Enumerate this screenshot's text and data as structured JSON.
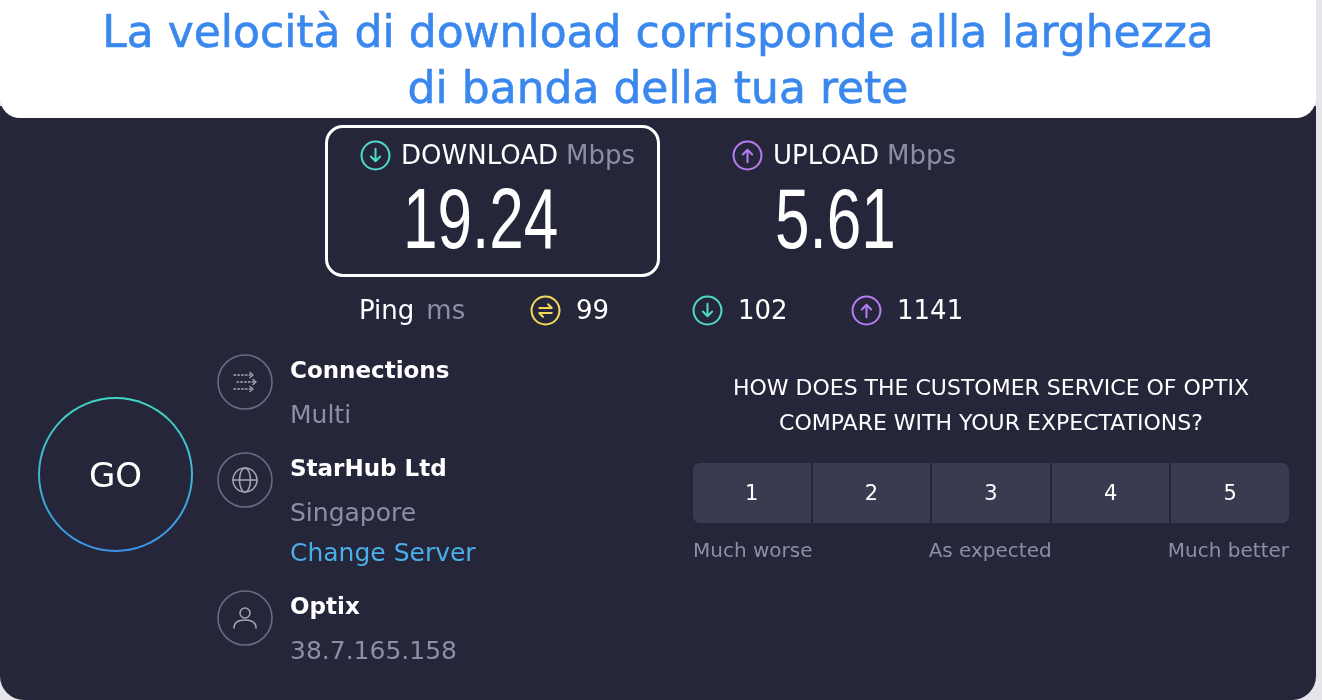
{
  "banner": {
    "text": "La velocità di download corrisponde alla larghezza di banda della tua rete"
  },
  "results": [
    {
      "kind": "download",
      "label": "DOWNLOAD",
      "unit": "Mbps",
      "value": "19.24",
      "color": "#4fd8c9",
      "selected": true
    },
    {
      "kind": "upload",
      "label": "UPLOAD",
      "unit": "Mbps",
      "value": "5.61",
      "color": "#b57cf0",
      "selected": false
    }
  ],
  "ping": {
    "label": "Ping",
    "unit": "ms",
    "values": [
      {
        "kind": "idle",
        "value": "99",
        "color": "#f2d95c"
      },
      {
        "kind": "download",
        "value": "102",
        "color": "#4fd8c9"
      },
      {
        "kind": "upload",
        "value": "1141",
        "color": "#b57cf0"
      }
    ]
  },
  "go_button": {
    "label": "GO"
  },
  "details": [
    {
      "kind": "connections",
      "title": "Connections",
      "subtitle": "Multi"
    },
    {
      "kind": "server",
      "title": "StarHub Ltd",
      "subtitle": "Singapore",
      "link": "Change Server"
    },
    {
      "kind": "provider",
      "title": "Optix",
      "subtitle": "38.7.165.158"
    }
  ],
  "survey": {
    "question": "HOW DOES THE CUSTOMER SERVICE OF OPTIX COMPARE WITH YOUR EXPECTATIONS?",
    "options": [
      {
        "label": "1",
        "selected": false
      },
      {
        "label": "2",
        "selected": false
      },
      {
        "label": "3",
        "selected": false
      },
      {
        "label": "4",
        "selected": false
      },
      {
        "label": "5",
        "selected": false
      }
    ],
    "scale_labels": [
      "Much worse",
      "As expected",
      "Much better"
    ]
  }
}
